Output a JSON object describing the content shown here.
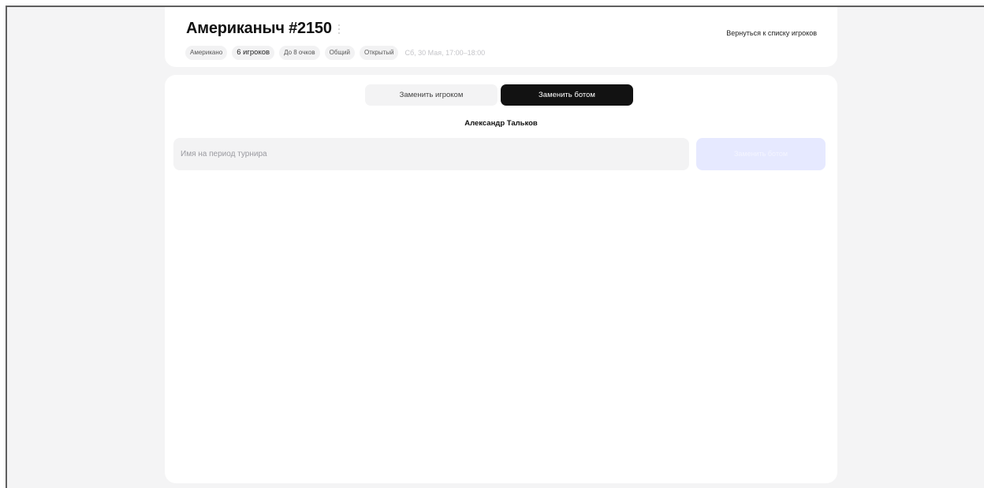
{
  "game": {
    "title": "Американыч #2150",
    "tags": [
      "Американо",
      "6 игроков",
      "До 8 очков",
      "Общий",
      "Открытый"
    ],
    "datetime": "Сб, 30 Мая, 17:00–18:00"
  },
  "header": {
    "back_label": "Вернуться к списку игроков"
  },
  "replace": {
    "tab_player": "Заменить игроком",
    "tab_bot": "Заменить ботом",
    "active_tab": "bot",
    "player_name": "Александр Тальков",
    "input_placeholder": "Имя на период турнира",
    "input_value": "",
    "submit_label": "Заменить ботом",
    "submit_disabled": true
  },
  "colors": {
    "page_bg": "#f4f4f5",
    "card_bg": "#ffffff",
    "active_tab_bg": "#121212",
    "disabled_button_bg": "#e6e9ff"
  }
}
